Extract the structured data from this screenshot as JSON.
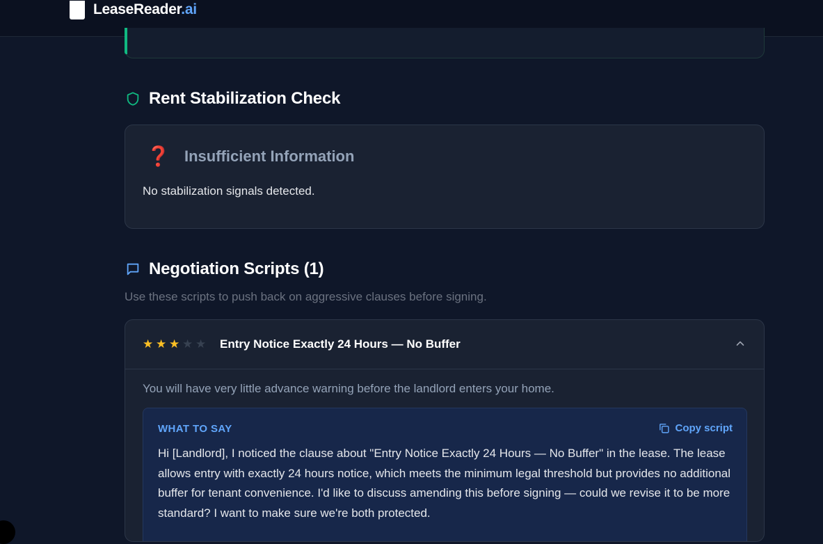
{
  "brand": {
    "name": "LeaseReader",
    "suffix": ".ai"
  },
  "stabilization": {
    "heading": "Rent Stabilization Check",
    "status_label": "Insufficient Information",
    "status_icon": "❓",
    "description": "No stabilization signals detected."
  },
  "negotiation": {
    "heading": "Negotiation Scripts (1)",
    "subtitle": "Use these scripts to push back on aggressive clauses before signing.",
    "scripts": [
      {
        "rating": 3,
        "rating_max": 5,
        "title": "Entry Notice Exactly 24 Hours — No Buffer",
        "description": "You will have very little advance warning before the landlord enters your home.",
        "what_to_say_label": "WHAT TO SAY",
        "copy_label": "Copy script",
        "script_text": "Hi [Landlord], I noticed the clause about \"Entry Notice Exactly 24 Hours — No Buffer\" in the lease. The lease allows entry with exactly 24 hours notice, which meets the minimum legal threshold but provides no additional buffer for tenant convenience. I'd like to discuss amending this before signing — could we revise it to be more standard? I want to make sure we're both protected."
      }
    ]
  },
  "colors": {
    "background": "#0f1729",
    "accent_blue": "#60a5fa",
    "accent_green": "#10b981",
    "star": "#fbbf24",
    "warning_red": "#e11d48"
  }
}
